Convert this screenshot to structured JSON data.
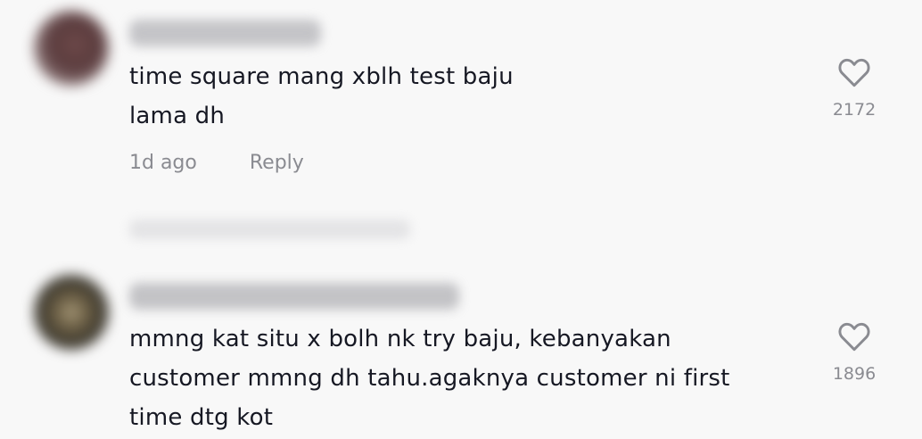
{
  "colors": {
    "background": "#f8f8f8",
    "text": "#161823",
    "muted": "#8a8b91"
  },
  "comments": [
    {
      "text": "time square mang xblh test baju\nlama dh",
      "time": "1d ago",
      "reply_label": "Reply",
      "like_icon": "heart-outline-icon",
      "likes": "2172"
    },
    {
      "text": "mmng kat situ x bolh nk try baju, kebanyakan\ncustomer mmng dh tahu.agaknya customer ni first\ntime dtg kot",
      "like_icon": "heart-outline-icon",
      "likes": "1896"
    }
  ]
}
